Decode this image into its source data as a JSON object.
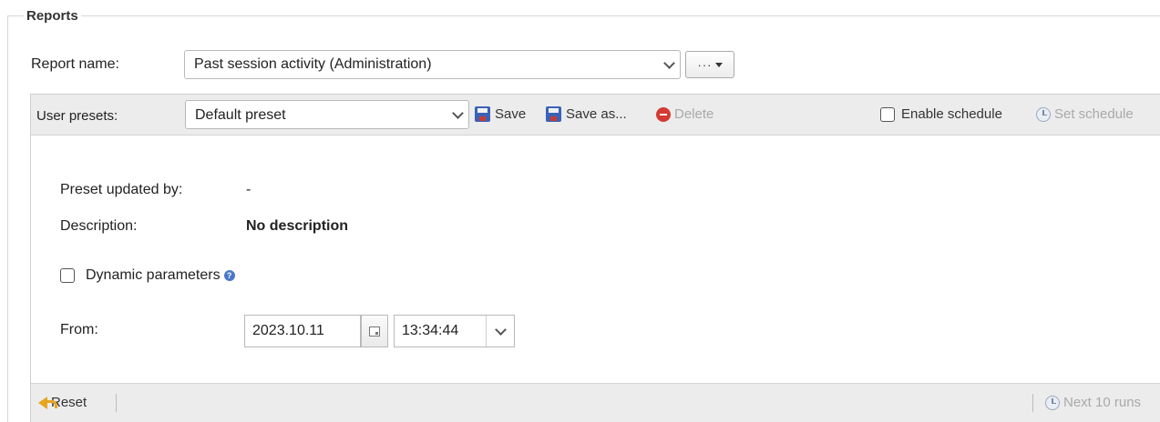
{
  "fieldset": {
    "legend": "Reports"
  },
  "report": {
    "label": "Report name:",
    "selected": "Past session activity (Administration)",
    "more_label": "···"
  },
  "presets": {
    "label": "User presets:",
    "selected": "Default preset",
    "save_label": "Save",
    "save_as_label": "Save as...",
    "delete_label": "Delete",
    "enable_schedule_label": "Enable schedule",
    "set_schedule_label": "Set schedule"
  },
  "details": {
    "updated_by_label": "Preset updated by:",
    "updated_by_value": "-",
    "description_label": "Description:",
    "description_value": "No description",
    "dynamic_params_label": "Dynamic parameters",
    "help_glyph": "?",
    "from_label": "From:",
    "from_date": "2023.10.11",
    "from_time": "13:34:44"
  },
  "footer": {
    "reset_label": "Reset",
    "next_runs_label": "Next 10 runs"
  },
  "colors": {
    "toolbar_bg": "#ececec",
    "disabled_text": "#a9a9a9",
    "save_icon": "#3a62b7",
    "delete_icon": "#d33a34",
    "reset_icon": "#e8a420"
  }
}
